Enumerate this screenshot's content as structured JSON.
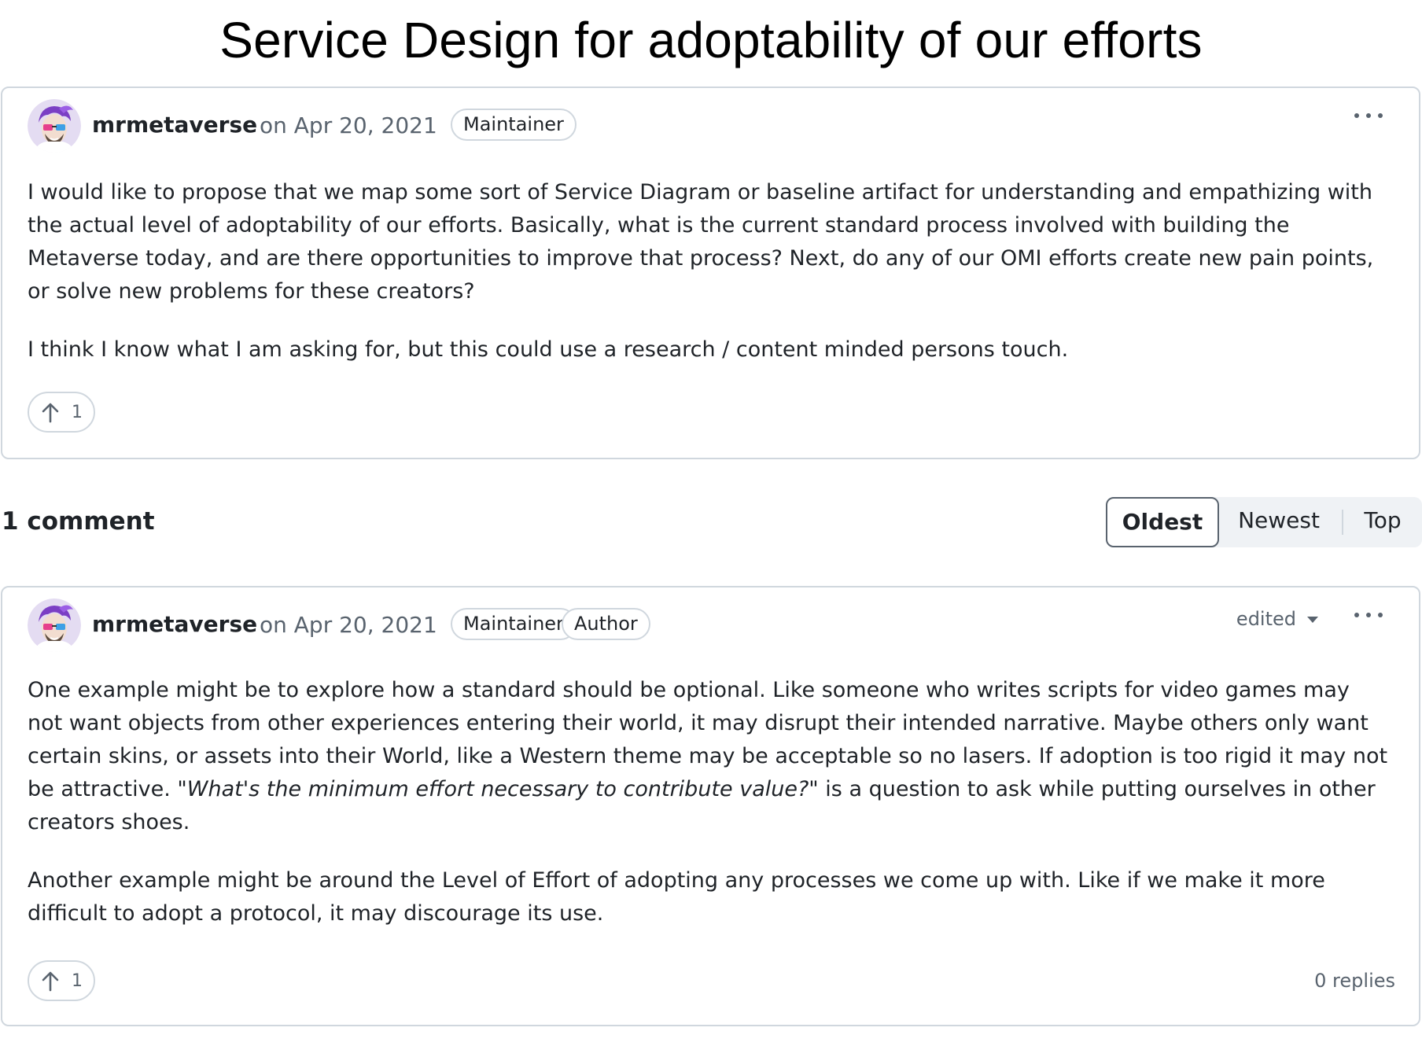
{
  "page_title": "Service Design for adoptability of our efforts",
  "post": {
    "author": "mrmetaverse",
    "date": "on Apr 20, 2021",
    "badges": [
      "Maintainer"
    ],
    "paragraphs": [
      "I would like to propose that we map some sort of Service Diagram or baseline artifact for understanding and empathizing with the actual level of adoptability of our efforts. Basically, what is the current standard process involved with building the Metaverse today, and are there opportunities to improve that process? Next, do any of our OMI efforts create new pain points, or solve new problems for these creators?",
      "I think I know what I am asking for, but this could use a research / content minded persons touch."
    ],
    "upvotes": "1"
  },
  "comments_header": {
    "count_label": "1 comment",
    "sort_options": [
      "Oldest",
      "Newest",
      "Top"
    ],
    "active_sort": "Oldest"
  },
  "comment": {
    "author": "mrmetaverse",
    "date": "on Apr 20, 2021",
    "badges": [
      "Maintainer",
      "Author"
    ],
    "edited_label": "edited",
    "p1_before": "One example might be to explore how a standard should be optional. Like someone who writes scripts for video games may not want objects from other experiences entering their world, it may disrupt their intended narrative. Maybe others only want certain skins, or assets into their World, like a Western theme may be acceptable so no lasers. If adoption is too rigid it may not be attractive. ",
    "p1_quote": "\"What's the minimum effort necessary to contribute value?\"",
    "p1_after": " is a question to ask while putting ourselves in other creators shoes.",
    "p2": "Another example might be around the Level of Effort of adopting any processes we come up with. Like if we make it more difficult to adopt a protocol, it may discourage its use.",
    "upvotes": "1",
    "replies": "0 replies"
  },
  "icons": {
    "avatar": "avatar-illustration",
    "more": "kebab-horizontal-icon",
    "upvote": "arrow-up-icon",
    "edited_caret": "triangle-down-icon"
  },
  "colors": {
    "border": "#d0d7de",
    "muted_text": "#59636e",
    "text": "#1f2328",
    "sort_bg": "#eff2f5"
  }
}
